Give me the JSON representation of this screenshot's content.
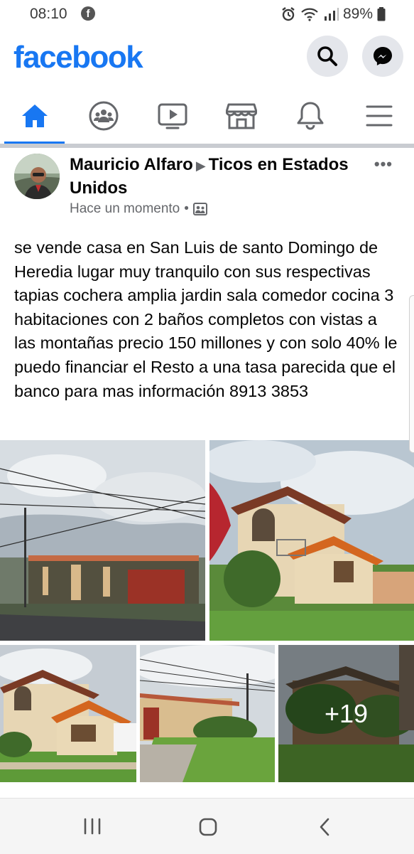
{
  "status_bar": {
    "time": "08:10",
    "battery": "89%"
  },
  "app": {
    "logo": "facebook",
    "brand_color": "#1877f2"
  },
  "header_buttons": [
    {
      "icon": "search-icon"
    },
    {
      "icon": "messenger-icon"
    }
  ],
  "tabs": [
    {
      "icon": "home-icon",
      "active": true
    },
    {
      "icon": "groups-icon"
    },
    {
      "icon": "watch-icon"
    },
    {
      "icon": "marketplace-icon"
    },
    {
      "icon": "notifications-icon"
    },
    {
      "icon": "menu-icon"
    }
  ],
  "post": {
    "author": "Mauricio Alfaro",
    "group": "Ticos en Estados Unidos",
    "time": "Hace un momento",
    "text": "se vende casa en San Luis de santo Domingo de Heredia lugar muy tranquilo con sus respectivas tapias cochera amplia jardin sala comedor cocina 3 habitaciones con 2 baños completos con vistas a las montañas precio 150 millones y con solo 40% le puedo financiar el Resto a una tasa parecida que el banco para mas información 8913 3853",
    "more_photos_label": "+19"
  },
  "android_nav": [
    {
      "icon": "recent-apps-icon"
    },
    {
      "icon": "home-circle-icon"
    },
    {
      "icon": "back-icon"
    }
  ]
}
